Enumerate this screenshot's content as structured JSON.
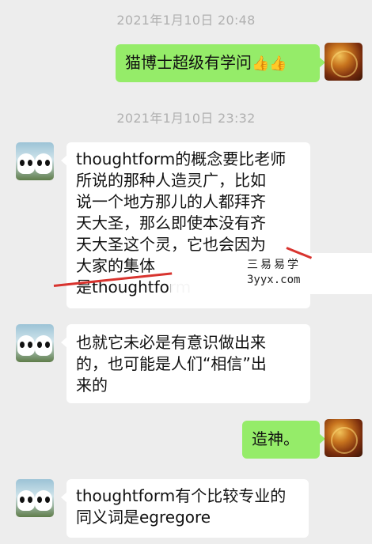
{
  "messages": [
    {
      "type": "timestamp",
      "text": "2021年1月10日 20:48"
    },
    {
      "type": "out",
      "text": "猫博士超级有学问",
      "emoji": "👍👍",
      "avatar_icon": "profile-photo-orange"
    },
    {
      "type": "timestamp",
      "text": "2021年1月10日 23:32"
    },
    {
      "type": "in",
      "lines": [
        "thoughtform的概念要比老师",
        "所说的那种人造灵广，比如",
        "说一个地方那儿的人都拜齐",
        "天大圣，那么即使本没有齐",
        "天大圣这个灵，它也会因为",
        "大家的集体",
        "是thoughtform"
      ],
      "avatar_icon": "panda-avatar"
    },
    {
      "type": "in",
      "lines": [
        "也就它未必是有意识做出来",
        "的，也可能是人们“相信”出",
        "来的"
      ],
      "avatar_icon": "panda-avatar"
    },
    {
      "type": "out",
      "text": "造神。",
      "avatar_icon": "profile-photo-orange"
    },
    {
      "type": "in",
      "lines": [
        "thoughtform有个比较专业的",
        "同义词是egregore"
      ],
      "avatar_icon": "panda-avatar"
    }
  ],
  "watermark": {
    "line1": "三易易学",
    "line2": "3yyx.com",
    "accent": "#d8342f"
  },
  "colors": {
    "background": "#ededed",
    "outgoing": "#95ec69",
    "incoming": "#ffffff",
    "timestamp": "#b0b0b0"
  }
}
